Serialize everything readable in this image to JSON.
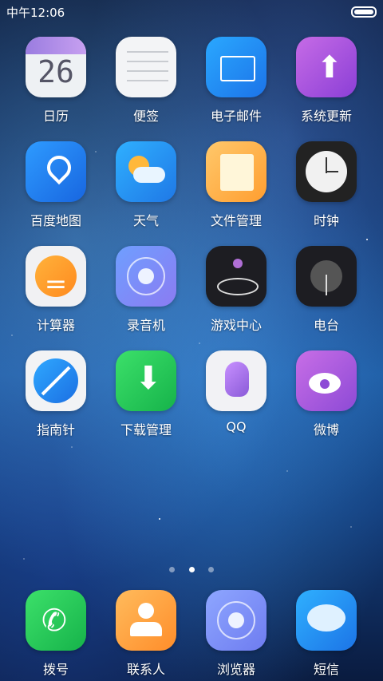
{
  "status_bar": {
    "time": "中午12:06"
  },
  "grid_rows": [
    [
      {
        "id": "calendar",
        "label": "日历",
        "day": "26",
        "icon": "calendar-icon"
      },
      {
        "id": "notes",
        "label": "便签",
        "icon": "notes-icon"
      },
      {
        "id": "email",
        "label": "电子邮件",
        "icon": "mail-icon"
      },
      {
        "id": "system-update",
        "label": "系统更新",
        "icon": "upload-arrow-icon"
      }
    ],
    [
      {
        "id": "baidu-map",
        "label": "百度地图",
        "icon": "map-pin-icon"
      },
      {
        "id": "weather",
        "label": "天气",
        "icon": "weather-sun-cloud-icon"
      },
      {
        "id": "file-manager",
        "label": "文件管理",
        "icon": "folder-document-icon"
      },
      {
        "id": "clock",
        "label": "时钟",
        "icon": "clock-icon"
      }
    ],
    [
      {
        "id": "calculator",
        "label": "计算器",
        "icon": "calculator-icon"
      },
      {
        "id": "recorder",
        "label": "录音机",
        "icon": "recorder-icon"
      },
      {
        "id": "game-center",
        "label": "游戏中心",
        "icon": "game-joystick-icon"
      },
      {
        "id": "radio",
        "label": "电台",
        "icon": "radio-icon"
      }
    ],
    [
      {
        "id": "compass",
        "label": "指南针",
        "icon": "compass-icon"
      },
      {
        "id": "download-manager",
        "label": "下载管理",
        "icon": "download-arrow-icon"
      },
      {
        "id": "qq",
        "label": "QQ",
        "icon": "qq-penguin-icon"
      },
      {
        "id": "weibo",
        "label": "微博",
        "icon": "weibo-icon"
      }
    ]
  ],
  "page_indicator": {
    "count": 3,
    "active": 2
  },
  "dock": [
    {
      "id": "dialer",
      "label": "拨号",
      "icon": "phone-icon"
    },
    {
      "id": "contacts",
      "label": "联系人",
      "icon": "contacts-icon"
    },
    {
      "id": "browser",
      "label": "浏览器",
      "icon": "browser-icon"
    },
    {
      "id": "messages",
      "label": "短信",
      "icon": "chat-bubble-icon"
    }
  ]
}
